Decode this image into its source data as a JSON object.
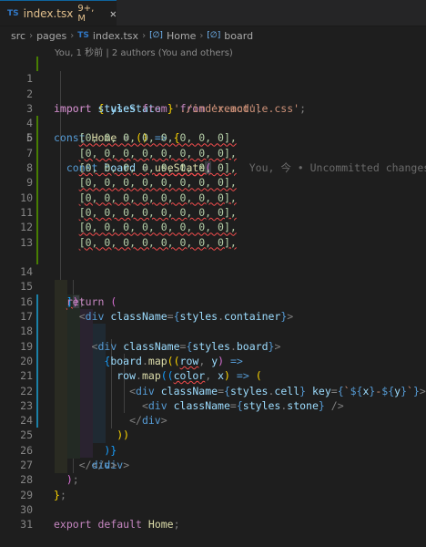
{
  "tab": {
    "badge": "TS",
    "name": "index.tsx",
    "status": "9+, M",
    "close": "✕"
  },
  "breadcrumb": {
    "items": [
      "src",
      "pages",
      "index.tsx",
      "Home",
      "board"
    ],
    "file_badge": "TS",
    "symbol_badge": "[∅]"
  },
  "codelens": "You, 1 秒前 | 2 authors (You and others)",
  "inline_blame": "You, 今 • Uncommitted changes",
  "lines": {
    "n": [
      "1",
      "2",
      "3",
      "4",
      "5",
      "6",
      "7",
      "8",
      "9",
      "10",
      "11",
      "12",
      "13",
      "14",
      "15",
      "16",
      "17",
      "18",
      "19",
      "20",
      "21",
      "22",
      "23",
      "24",
      "25",
      "26",
      "27",
      "28",
      "29",
      "30",
      "31"
    ],
    "l1": [
      "import",
      "{",
      "useState",
      "}",
      "from",
      "'react'",
      ";"
    ],
    "l2": [
      "import",
      "styles",
      "from",
      "'./index.module.css'",
      ";"
    ],
    "l4": [
      "const",
      "Home",
      "=",
      "()",
      "=>",
      "{"
    ],
    "l5": [
      "const",
      "board",
      "=",
      "useState",
      "("
    ],
    "row": "[0, 0, 0, 0, 0, 0, 0, 0],",
    "l14": [
      "]",
      ")",
      ";"
    ],
    "l15": [
      "return",
      "("
    ],
    "l16": [
      "<",
      "div",
      "className",
      "=",
      "{",
      "styles",
      ".",
      "container",
      "}",
      ">"
    ],
    "l17": [
      "<",
      "div",
      "className",
      "=",
      "{",
      "styles",
      ".",
      "board",
      "}",
      ">"
    ],
    "l18": [
      "{",
      "board",
      ".",
      "map",
      "((",
      "row",
      ",",
      "y",
      ")",
      "=>"
    ],
    "l19": [
      "row",
      ".",
      "map",
      "((",
      "color",
      ",",
      "x",
      ")",
      "=>",
      "("
    ],
    "l20": [
      "<",
      "div",
      "className",
      "=",
      "{",
      "styles",
      ".",
      "cell",
      "}",
      "key",
      "=",
      "{",
      "`",
      "${",
      "x",
      "}",
      "-",
      "${",
      "y",
      "}",
      "`",
      "}",
      ">"
    ],
    "l21": [
      "<",
      "div",
      "className",
      "=",
      "{",
      "styles",
      ".",
      "stone",
      "}",
      "/>"
    ],
    "l22": [
      "</",
      "div",
      ">"
    ],
    "l23": [
      "))"
    ],
    "l24": [
      ")}"
    ],
    "l25": [
      "</",
      "div",
      ">"
    ],
    "l26": [
      "</",
      "div",
      ">"
    ],
    "l27": [
      ")",
      ";"
    ],
    "l28": [
      "}",
      ";"
    ],
    "l30": [
      "export",
      "default",
      "Home",
      ";"
    ]
  }
}
